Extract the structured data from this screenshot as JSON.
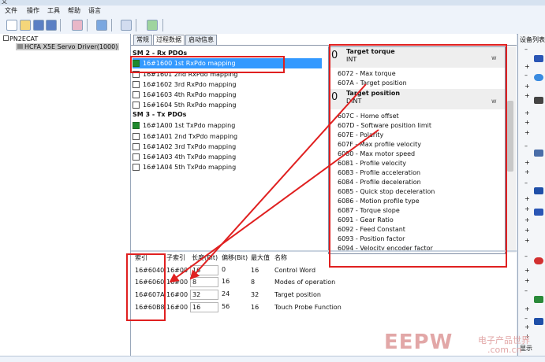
{
  "title_fragment": "文",
  "menu": [
    "文件",
    "操作",
    "工具",
    "帮助",
    "语言"
  ],
  "tree": {
    "root": "PN2ECAT",
    "child": "HCFA X5E Servo Driver(1000)"
  },
  "tabs": [
    "常规",
    "过程数据",
    "启动信息"
  ],
  "rx_header": "SM 2 - Rx PDOs",
  "tx_header": "SM 3 - Tx PDOs",
  "rx_pdos": [
    {
      "label": "16#1600   1st RxPdo mapping",
      "checked": true,
      "selected": true
    },
    {
      "label": "16#1601   2nd RxPdo mapping",
      "checked": false
    },
    {
      "label": "16#1602   3rd RxPdo mapping",
      "checked": false
    },
    {
      "label": "16#1603   4th RxPdo mapping",
      "checked": false
    },
    {
      "label": "16#1604   5th RxPdo mapping",
      "checked": false
    }
  ],
  "tx_pdos": [
    {
      "label": "16#1A00   1st TxPdo mapping",
      "checked": true
    },
    {
      "label": "16#1A01   2nd TxPdo mapping",
      "checked": false
    },
    {
      "label": "16#1A02   3rd TxPdo mapping",
      "checked": false
    },
    {
      "label": "16#1A03   4th TxPdo mapping",
      "checked": false
    },
    {
      "label": "16#1A04   5th TxPdo mapping",
      "checked": false
    }
  ],
  "dropdown": {
    "group1": {
      "num": "0",
      "title": "Target torque",
      "type": "INT"
    },
    "items1": [
      "6072 - Max torque",
      "607A - Target position"
    ],
    "group2": {
      "num": "0",
      "title": "Target position",
      "type": "DINT"
    },
    "items2": [
      "607C - Home offset",
      "607D - Software position limit",
      "607E - Polarity",
      "607F - Max profile velocity",
      "6080 - Max motor speed",
      "6081 - Profile velocity",
      "6083 - Profile acceleration",
      "6084 - Profile deceleration",
      "6085 - Quick stop deceleration",
      "6086 - Motion profile type",
      "6087 - Torque slope",
      "6091 - Gear Ratio",
      "6092 - Feed Constant",
      "6093 - Position factor",
      "6094 - Velocity encoder factor"
    ],
    "side_letter": "w"
  },
  "table": {
    "headers": [
      "索引",
      "子索引",
      "长度(Bit)",
      "偏移(Bit)",
      "最大值",
      "名称"
    ],
    "rows": [
      {
        "index": "16#6040",
        "sub": "16#00",
        "len": "16",
        "offset": "0",
        "max": "16",
        "name": "Control Word"
      },
      {
        "index": "16#6060",
        "sub": "16#00",
        "len": "8",
        "offset": "16",
        "max": "8",
        "name": "Modes of operation"
      },
      {
        "index": "16#607A",
        "sub": "16#00",
        "len": "32",
        "offset": "24",
        "max": "32",
        "name": "Target position"
      },
      {
        "index": "16#60B8",
        "sub": "16#00",
        "len": "16",
        "offset": "56",
        "max": "16",
        "name": "Touch Probe Function"
      }
    ]
  },
  "right_pane": {
    "header": "设备列表",
    "footer": "显示"
  },
  "watermark": {
    "logo": "EEPW",
    "cn": "电子产品世界",
    "domain": ".com.cn"
  },
  "colors": {
    "selection": "#3399ff",
    "annotation": "#e02020",
    "checked": "#1e8a2e"
  }
}
